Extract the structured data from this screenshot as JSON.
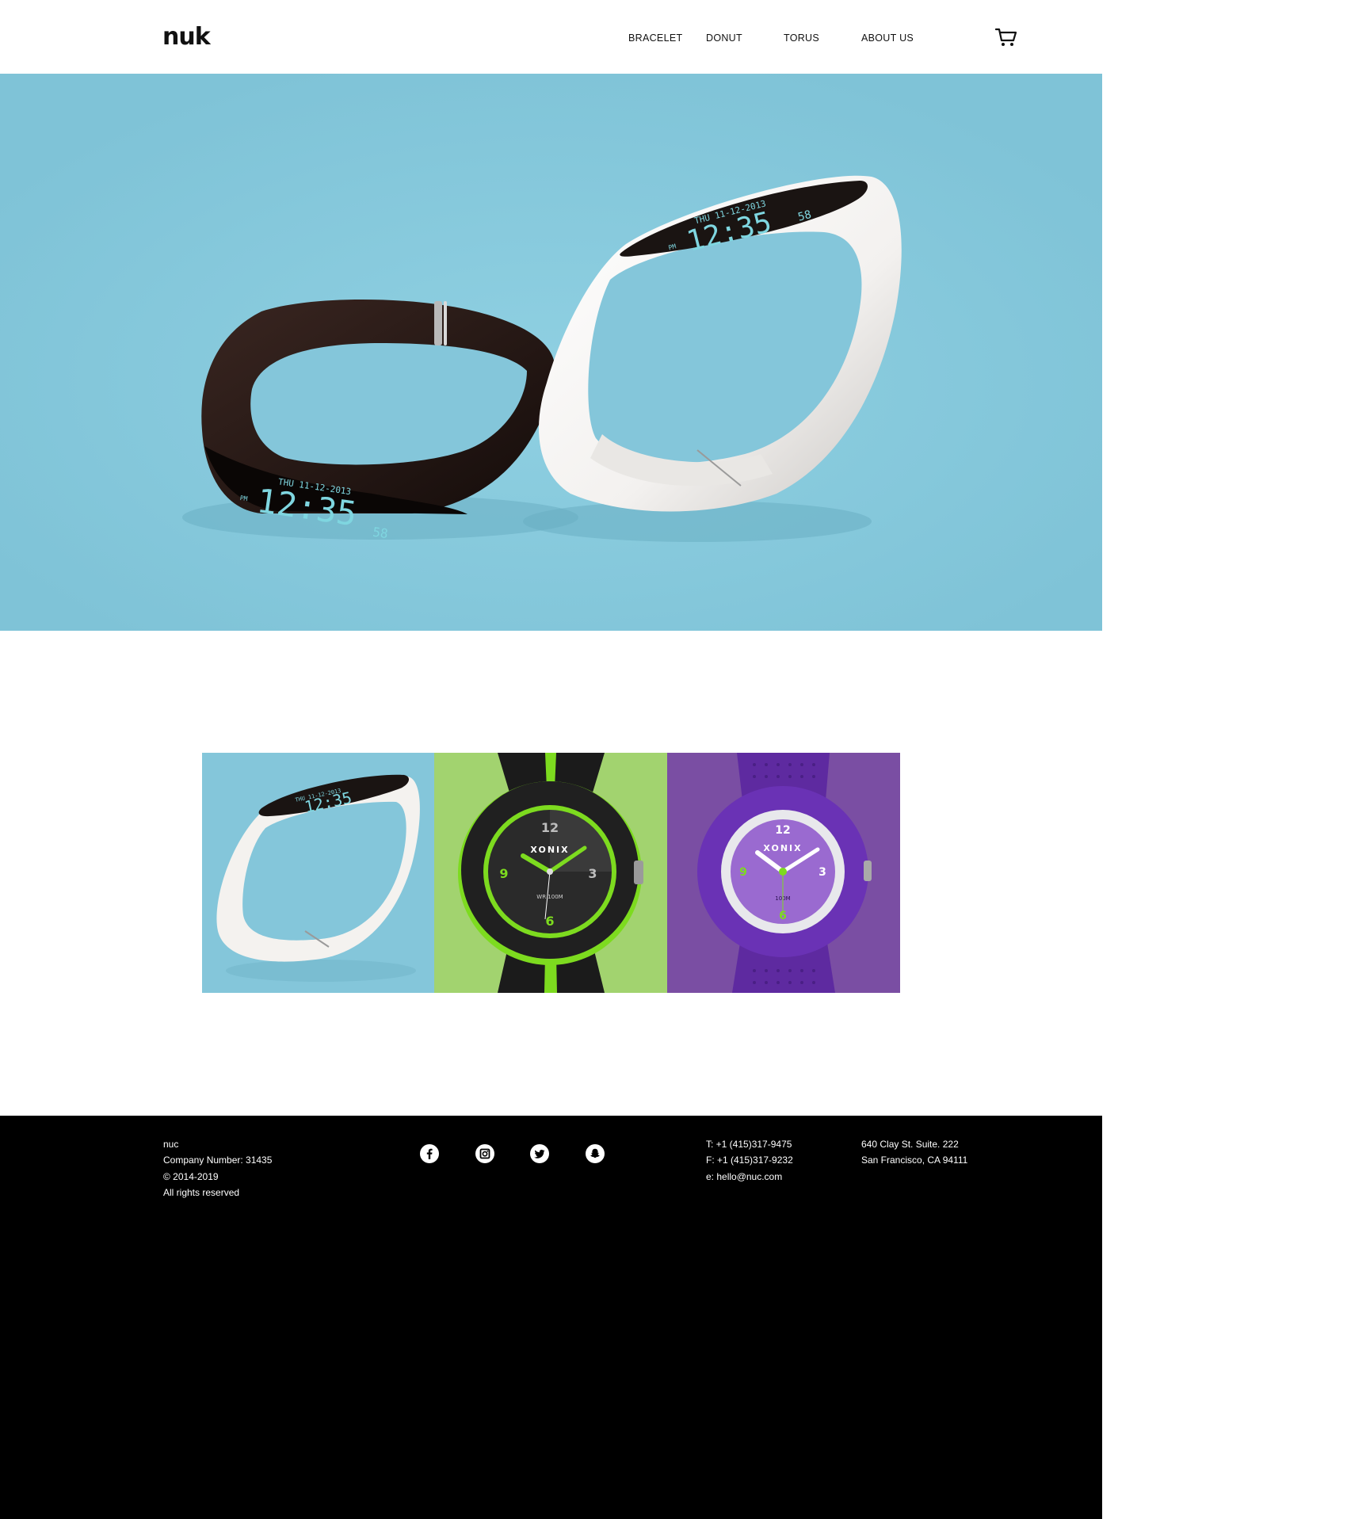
{
  "brand": {
    "logo_text": "nuk"
  },
  "nav": {
    "items": [
      {
        "label": "BRACELET"
      },
      {
        "label": "DONUT"
      },
      {
        "label": "TORUS"
      },
      {
        "label": "ABOUT US"
      }
    ],
    "cart_icon": "cart-icon"
  },
  "hero": {
    "image": "bracelet-pair-image",
    "dark_display": {
      "day_date": "THU 11-12-2013",
      "time": "12:35",
      "period": "PM",
      "seconds": "58"
    },
    "white_display": {
      "day_date": "THU 11-12-2013",
      "time": "12:35",
      "period": "PM",
      "seconds": "58"
    }
  },
  "gallery": {
    "tiles": [
      {
        "image": "white-bracelet-image",
        "display_time": "12:35",
        "display_date": "THU 11-12-2013"
      },
      {
        "image": "green-watch-image",
        "brand": "XONIX",
        "depth": "WR 100M",
        "numerals": [
          "12",
          "3",
          "6",
          "9"
        ]
      },
      {
        "image": "purple-watch-image",
        "brand": "XONIX",
        "depth": "100M",
        "numerals": [
          "12",
          "3",
          "6",
          "9"
        ]
      }
    ]
  },
  "footer": {
    "company": {
      "name": "nuc",
      "number": "Company Number: 31435",
      "copyright": "© 2014-2019",
      "rights": "All rights reserved"
    },
    "social": [
      {
        "icon": "facebook-icon"
      },
      {
        "icon": "instagram-icon"
      },
      {
        "icon": "twitter-icon"
      },
      {
        "icon": "snapchat-icon"
      }
    ],
    "contact": {
      "phone": "T: +1 (415)317-9475",
      "fax": "F: +1 (415)317-9232",
      "email": "e: hello@nuc.com"
    },
    "address": {
      "line1": "640 Clay St. Suite. 222",
      "line2": "San Francisco, CA 94111"
    }
  },
  "colors": {
    "hero_bg": "#84c6da",
    "tile_green": "#a2d36f",
    "tile_purple": "#7a4ea3",
    "footer_bg": "#000000",
    "display_text": "#7fd6e0",
    "accent_green": "#7ddb1f"
  }
}
